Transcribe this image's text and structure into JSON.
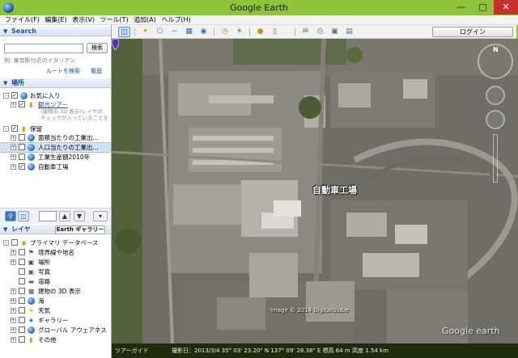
{
  "window": {
    "title": "Google Earth"
  },
  "menu": [
    "ファイル(F)",
    "編集(E)",
    "表示(V)",
    "ツール(T)",
    "追加(A)",
    "ヘルプ(H)"
  ],
  "toolbar": {
    "icons": [
      "sidebar-toggle-icon",
      "placemark-icon",
      "polygon-icon",
      "path-icon",
      "image-overlay-icon",
      "record-tour-icon",
      "historical-imagery-icon",
      "sunlight-icon",
      "planets-icon",
      "ruler-icon",
      "email-icon",
      "print-icon",
      "save-image-icon",
      "view-in-maps-icon"
    ],
    "login_label": "ログイン"
  },
  "search": {
    "title": "Search",
    "button_label": "検索",
    "input_value": "",
    "example": "例: 東京駅付近のイタリアン",
    "route_label": "ルートを検索",
    "history_label": "履歴"
  },
  "places": {
    "title": "場所",
    "favorites": "お気に入り",
    "tour": "観光ツアー",
    "tour_desc_1": "(建物の 3D 表示)レイヤの",
    "tour_desc_2": "チェックが入っていることを",
    "saved": "保留",
    "items": [
      "面積当たりの工業出…",
      "人口当たりの工業出…",
      "工業生産額2010年",
      "自動車工場"
    ]
  },
  "layers": {
    "title": "レイヤ",
    "gallery_label": "Earth ギャラリー",
    "primary": "プライマリ データベース",
    "items": [
      "境界線や地名",
      "場所",
      "写真",
      "道路",
      "建物の 3D 表示",
      "海",
      "天気",
      "ギャラリー",
      "グローバル アウェアネス",
      "その他"
    ]
  },
  "map": {
    "placemark_label": "自動車工場",
    "copyright": "Image © 2014 DigitalGlobe",
    "watermark": "Google earth",
    "compass_n": "N"
  },
  "status": {
    "tour_label": "ツアーガイド",
    "text": "撮影日：2013/3/4    35° 03' 23.20\" N  137° 09' 28.38\" E  標高   64 m    高度   1.54 km"
  },
  "colors": {
    "accent": "#8fc33a",
    "link": "#1f4e9a",
    "close": "#c7302b"
  }
}
